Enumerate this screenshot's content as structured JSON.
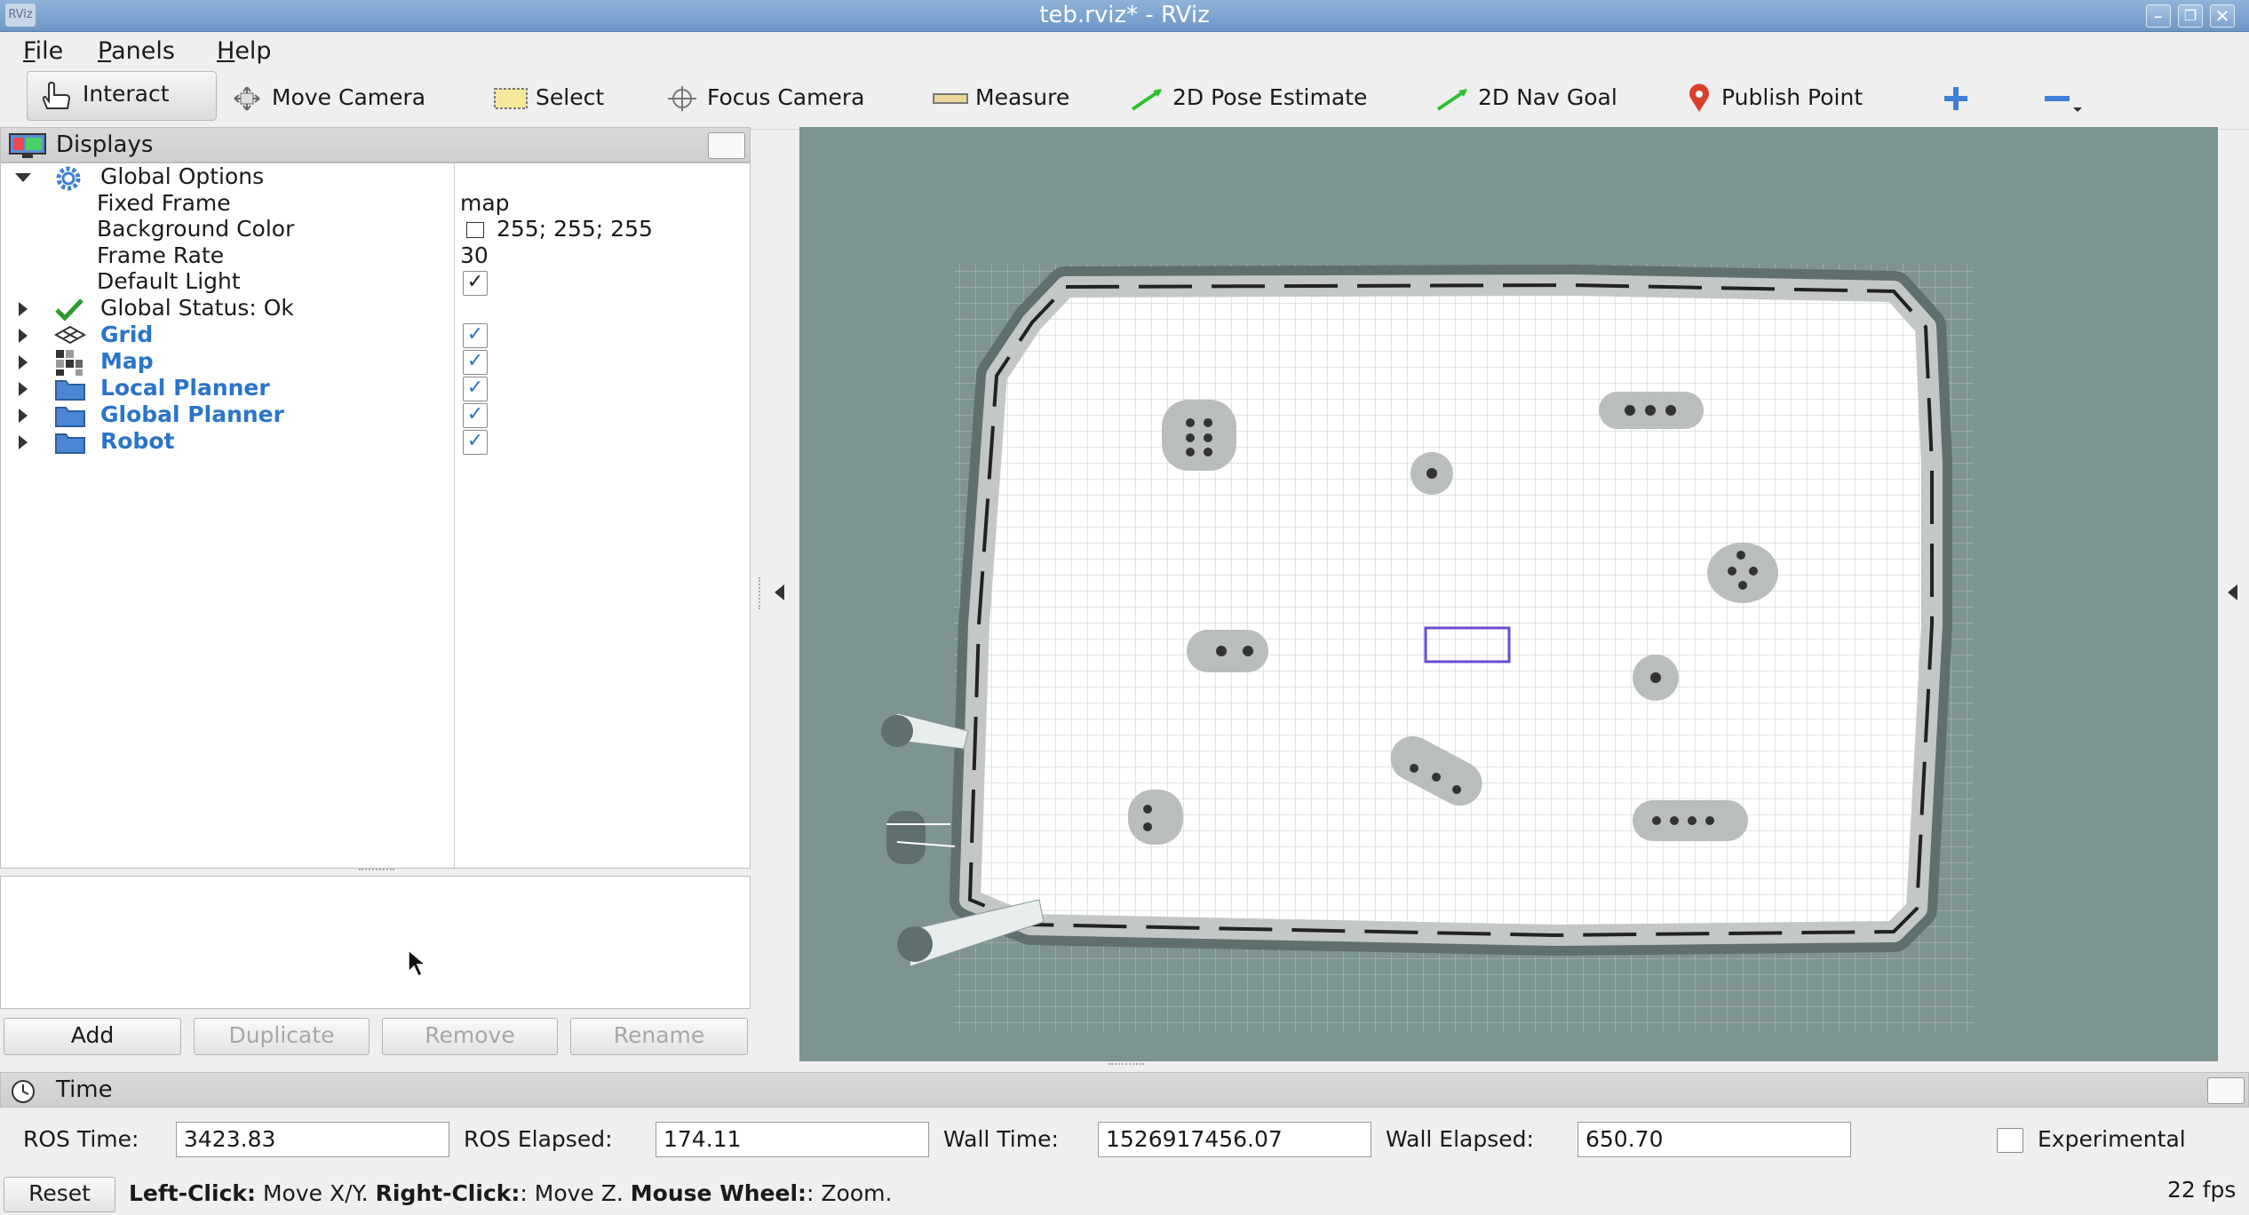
{
  "window": {
    "title": "teb.rviz* - RViz",
    "icon_text": "RViz"
  },
  "menu": [
    {
      "label": "File",
      "u": "F"
    },
    {
      "label": "Panels",
      "u": "P"
    },
    {
      "label": "Help",
      "u": "H"
    }
  ],
  "toolbar": {
    "interact": "Interact",
    "move_camera": "Move Camera",
    "select": "Select",
    "focus_camera": "Focus Camera",
    "measure": "Measure",
    "pose_estimate": "2D Pose Estimate",
    "nav_goal": "2D Nav Goal",
    "publish_point": "Publish Point"
  },
  "displays": {
    "title": "Displays",
    "global_options": "Global Options",
    "fixed_frame_label": "Fixed Frame",
    "fixed_frame_value": "map",
    "bg_color_label": "Background Color",
    "bg_color_value": "255; 255; 255",
    "frame_rate_label": "Frame Rate",
    "frame_rate_value": "30",
    "default_light_label": "Default Light",
    "global_status": "Global Status: Ok",
    "items": [
      "Grid",
      "Map",
      "Local Planner",
      "Global Planner",
      "Robot"
    ]
  },
  "buttons": {
    "add": "Add",
    "duplicate": "Duplicate",
    "remove": "Remove",
    "rename": "Rename"
  },
  "time_panel": {
    "title": "Time",
    "ros_time_label": "ROS Time:",
    "ros_time": "3423.83",
    "ros_elapsed_label": "ROS Elapsed:",
    "ros_elapsed": "174.11",
    "wall_time_label": "Wall Time:",
    "wall_time": "1526917456.07",
    "wall_elapsed_label": "Wall Elapsed:",
    "wall_elapsed": "650.70",
    "experimental": "Experimental"
  },
  "status": {
    "reset": "Reset",
    "left_click": "Left-Click:",
    "left_click_desc": " Move X/Y. ",
    "right_click": "Right-Click:",
    "right_click_desc": ": Move Z. ",
    "wheel": "Mouse Wheel:",
    "wheel_desc": ": Zoom.",
    "fps": "22 fps"
  },
  "colors": {
    "viewport_bg": "#7d9490",
    "link": "#2a74c9",
    "goal_box": "#6a4bd0"
  }
}
